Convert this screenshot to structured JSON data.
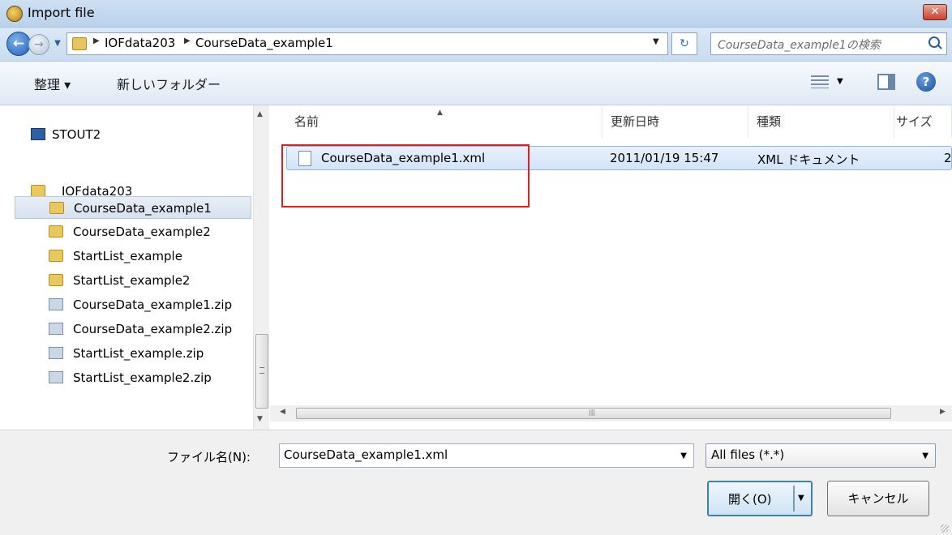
{
  "window": {
    "title": "Import file",
    "close_label": "✕"
  },
  "address": {
    "segments": [
      "IOFdata203",
      "CourseData_example1"
    ],
    "search_placeholder": "CourseData_example1の検索"
  },
  "toolbar": {
    "organize_label": "整理 ▾",
    "new_folder_label": "新しいフォルダー"
  },
  "nav": {
    "items": [
      {
        "label": "STOUT2",
        "icon": "computer-icon"
      },
      {
        "label": "IOFdata203",
        "icon": "folder-icon"
      },
      {
        "label": "CourseData_example1",
        "icon": "folder-icon",
        "selected": true
      },
      {
        "label": "CourseData_example2",
        "icon": "folder-icon"
      },
      {
        "label": "StartList_example",
        "icon": "folder-icon"
      },
      {
        "label": "StartList_example2",
        "icon": "folder-icon"
      },
      {
        "label": "CourseData_example1.zip",
        "icon": "zip-icon"
      },
      {
        "label": "CourseData_example2.zip",
        "icon": "zip-icon"
      },
      {
        "label": "StartList_example.zip",
        "icon": "zip-icon"
      },
      {
        "label": "StartList_example2.zip",
        "icon": "zip-icon"
      }
    ]
  },
  "files": {
    "columns": [
      "名前",
      "更新日時",
      "種類",
      "サイズ"
    ],
    "rows": [
      {
        "name": "CourseData_example1.xml",
        "modified": "2011/01/19 15:47",
        "type": "XML ドキュメント",
        "size": "2"
      }
    ]
  },
  "footer": {
    "filename_label": "ファイル名(N):",
    "filename_value": "CourseData_example1.xml",
    "filter_value": "All files (*.*)",
    "open_label": "開く(O)",
    "cancel_label": "キャンセル"
  },
  "colors": {
    "selection": "#d2e4f8",
    "highlight_box": "#e02020",
    "accent": "#3c7fb1"
  }
}
